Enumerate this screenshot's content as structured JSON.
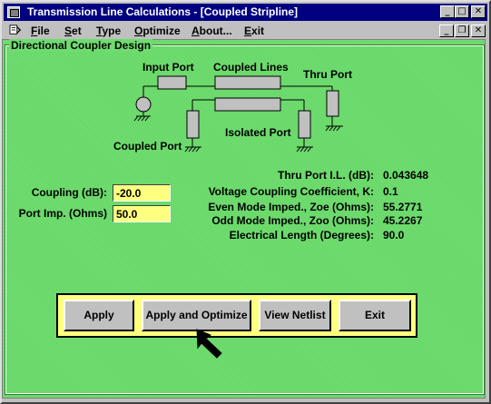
{
  "window": {
    "title": "Transmission Line Calculations - [Coupled Stripline]",
    "buttons": {
      "minimize": "_",
      "maximize": "□",
      "close": "✕",
      "restore": "❐"
    }
  },
  "menu": [
    {
      "label": "File",
      "underline": "F",
      "rest": "ile"
    },
    {
      "label": "Set",
      "underline": "S",
      "rest": "et"
    },
    {
      "label": "Type",
      "underline": "T",
      "rest": "ype"
    },
    {
      "label": "Optimize",
      "underline": "O",
      "rest": "ptimize"
    },
    {
      "label": "About...",
      "underline": "A",
      "rest": "bout..."
    },
    {
      "label": "Exit",
      "underline": "E",
      "rest": "xit"
    }
  ],
  "panel_title": "Directional Coupler Design",
  "diagram": {
    "input_port": "Input Port",
    "coupled_lines": "Coupled Lines",
    "thru_port": "Thru Port",
    "coupled_port": "Coupled Port",
    "isolated_port": "Isolated Port"
  },
  "inputs": {
    "coupling_label": "Coupling (dB):",
    "coupling_value": "-20.0",
    "port_imp_label": "Port Imp. (Ohms)",
    "port_imp_value": "50.0"
  },
  "results": [
    {
      "label": "Thru Port I.L. (dB):",
      "value": "0.043648"
    },
    {
      "label": "Voltage Coupling Coefficient, K:",
      "value": "0.1"
    },
    {
      "label": "Even Mode Imped., Zoe (Ohms):",
      "value": "55.2771"
    },
    {
      "label": "Odd Mode Imped., Zoo (Ohms):",
      "value": "45.2267"
    },
    {
      "label": "Electrical Length (Degrees):",
      "value": "90.0"
    }
  ],
  "actions": {
    "apply": "Apply",
    "apply_optimize": "Apply and Optimize",
    "view_netlist": "View Netlist",
    "exit": "Exit"
  },
  "colors": {
    "client_bg": "#6edc6e",
    "field_bg": "#ffff80",
    "titlebar": "#000080"
  },
  "cursor": "arrow-pointer-icon"
}
